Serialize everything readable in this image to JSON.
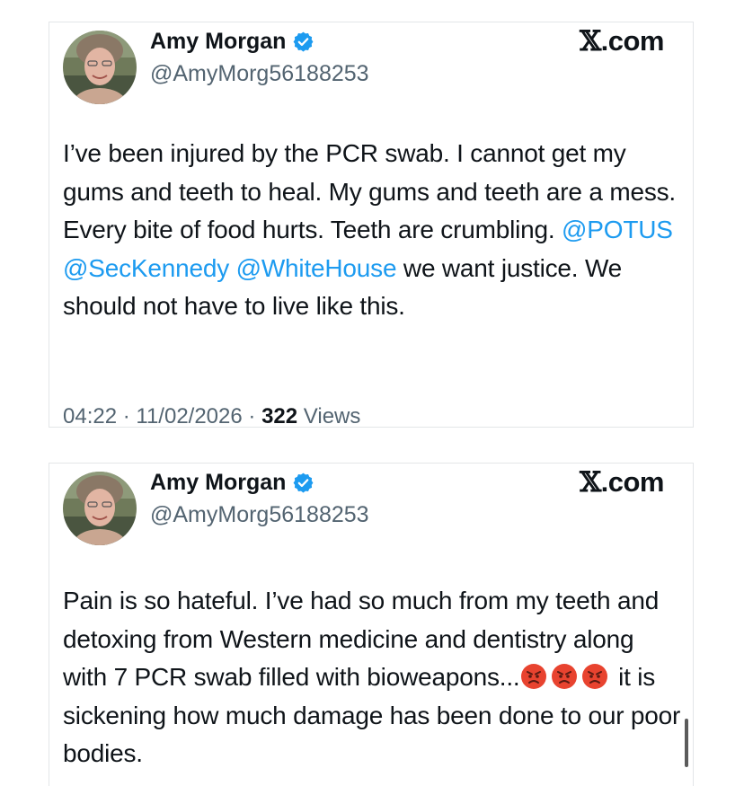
{
  "tweets": [
    {
      "author": {
        "name": "Amy Morgan",
        "handle": "@AmyMorg56188253"
      },
      "source": {
        "mark": "𝕏",
        "domain": ".com"
      },
      "body": {
        "text1": "I’ve been injured by the PCR swab. I cannot get my gums and teeth to heal. My gums and teeth are a mess. Every bite of food hurts. Teeth are crumbling. ",
        "mention1": "@POTUS",
        "mention2": "@SecKennedy",
        "mention3": "@WhiteHouse",
        "text2": " we want justice. We should not have to live like this."
      },
      "meta": {
        "time": "04:22",
        "date": "11/02/2026",
        "views_count": "322",
        "views_label": "Views"
      }
    },
    {
      "author": {
        "name": "Amy Morgan",
        "handle": "@AmyMorg56188253"
      },
      "source": {
        "mark": "𝕏",
        "domain": ".com"
      },
      "body": {
        "text1": "Pain is so hateful. I’ve had so much from my teeth and detoxing from Western medicine and dentistry along with 7 PCR swab filled with bioweapons...",
        "emojis": [
          "angry-face",
          "angry-face",
          "angry-face"
        ],
        "text2": " it is sickening how much damage has been done to our poor bodies."
      }
    }
  ],
  "colors": {
    "text": "#0f1419",
    "secondary": "#536471",
    "mention": "#1d9bf0",
    "verified": "#1d9bf0",
    "border": "#e3e6e8",
    "emoji": "#e8432f"
  }
}
